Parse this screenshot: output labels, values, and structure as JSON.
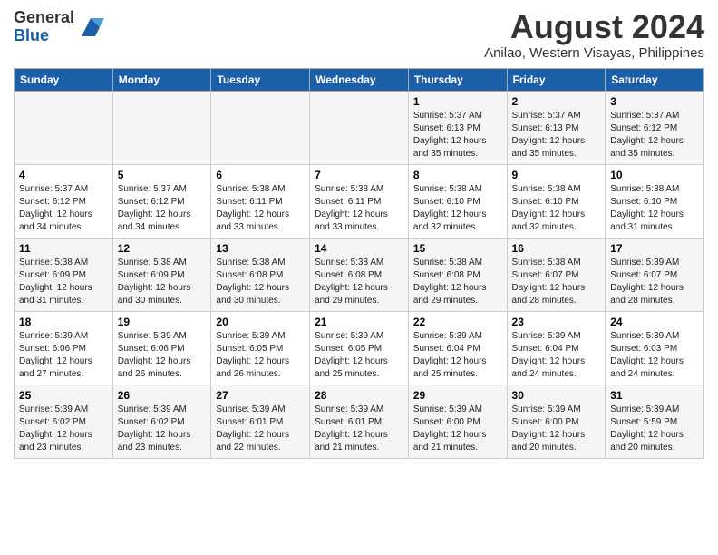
{
  "header": {
    "logo_line1": "General",
    "logo_line2": "Blue",
    "month_title": "August 2024",
    "subtitle": "Anilao, Western Visayas, Philippines"
  },
  "calendar": {
    "days_of_week": [
      "Sunday",
      "Monday",
      "Tuesday",
      "Wednesday",
      "Thursday",
      "Friday",
      "Saturday"
    ],
    "weeks": [
      [
        {
          "day": "",
          "info": ""
        },
        {
          "day": "",
          "info": ""
        },
        {
          "day": "",
          "info": ""
        },
        {
          "day": "",
          "info": ""
        },
        {
          "day": "1",
          "info": "Sunrise: 5:37 AM\nSunset: 6:13 PM\nDaylight: 12 hours\nand 35 minutes."
        },
        {
          "day": "2",
          "info": "Sunrise: 5:37 AM\nSunset: 6:13 PM\nDaylight: 12 hours\nand 35 minutes."
        },
        {
          "day": "3",
          "info": "Sunrise: 5:37 AM\nSunset: 6:12 PM\nDaylight: 12 hours\nand 35 minutes."
        }
      ],
      [
        {
          "day": "4",
          "info": "Sunrise: 5:37 AM\nSunset: 6:12 PM\nDaylight: 12 hours\nand 34 minutes."
        },
        {
          "day": "5",
          "info": "Sunrise: 5:37 AM\nSunset: 6:12 PM\nDaylight: 12 hours\nand 34 minutes."
        },
        {
          "day": "6",
          "info": "Sunrise: 5:38 AM\nSunset: 6:11 PM\nDaylight: 12 hours\nand 33 minutes."
        },
        {
          "day": "7",
          "info": "Sunrise: 5:38 AM\nSunset: 6:11 PM\nDaylight: 12 hours\nand 33 minutes."
        },
        {
          "day": "8",
          "info": "Sunrise: 5:38 AM\nSunset: 6:10 PM\nDaylight: 12 hours\nand 32 minutes."
        },
        {
          "day": "9",
          "info": "Sunrise: 5:38 AM\nSunset: 6:10 PM\nDaylight: 12 hours\nand 32 minutes."
        },
        {
          "day": "10",
          "info": "Sunrise: 5:38 AM\nSunset: 6:10 PM\nDaylight: 12 hours\nand 31 minutes."
        }
      ],
      [
        {
          "day": "11",
          "info": "Sunrise: 5:38 AM\nSunset: 6:09 PM\nDaylight: 12 hours\nand 31 minutes."
        },
        {
          "day": "12",
          "info": "Sunrise: 5:38 AM\nSunset: 6:09 PM\nDaylight: 12 hours\nand 30 minutes."
        },
        {
          "day": "13",
          "info": "Sunrise: 5:38 AM\nSunset: 6:08 PM\nDaylight: 12 hours\nand 30 minutes."
        },
        {
          "day": "14",
          "info": "Sunrise: 5:38 AM\nSunset: 6:08 PM\nDaylight: 12 hours\nand 29 minutes."
        },
        {
          "day": "15",
          "info": "Sunrise: 5:38 AM\nSunset: 6:08 PM\nDaylight: 12 hours\nand 29 minutes."
        },
        {
          "day": "16",
          "info": "Sunrise: 5:38 AM\nSunset: 6:07 PM\nDaylight: 12 hours\nand 28 minutes."
        },
        {
          "day": "17",
          "info": "Sunrise: 5:39 AM\nSunset: 6:07 PM\nDaylight: 12 hours\nand 28 minutes."
        }
      ],
      [
        {
          "day": "18",
          "info": "Sunrise: 5:39 AM\nSunset: 6:06 PM\nDaylight: 12 hours\nand 27 minutes."
        },
        {
          "day": "19",
          "info": "Sunrise: 5:39 AM\nSunset: 6:06 PM\nDaylight: 12 hours\nand 26 minutes."
        },
        {
          "day": "20",
          "info": "Sunrise: 5:39 AM\nSunset: 6:05 PM\nDaylight: 12 hours\nand 26 minutes."
        },
        {
          "day": "21",
          "info": "Sunrise: 5:39 AM\nSunset: 6:05 PM\nDaylight: 12 hours\nand 25 minutes."
        },
        {
          "day": "22",
          "info": "Sunrise: 5:39 AM\nSunset: 6:04 PM\nDaylight: 12 hours\nand 25 minutes."
        },
        {
          "day": "23",
          "info": "Sunrise: 5:39 AM\nSunset: 6:04 PM\nDaylight: 12 hours\nand 24 minutes."
        },
        {
          "day": "24",
          "info": "Sunrise: 5:39 AM\nSunset: 6:03 PM\nDaylight: 12 hours\nand 24 minutes."
        }
      ],
      [
        {
          "day": "25",
          "info": "Sunrise: 5:39 AM\nSunset: 6:02 PM\nDaylight: 12 hours\nand 23 minutes."
        },
        {
          "day": "26",
          "info": "Sunrise: 5:39 AM\nSunset: 6:02 PM\nDaylight: 12 hours\nand 23 minutes."
        },
        {
          "day": "27",
          "info": "Sunrise: 5:39 AM\nSunset: 6:01 PM\nDaylight: 12 hours\nand 22 minutes."
        },
        {
          "day": "28",
          "info": "Sunrise: 5:39 AM\nSunset: 6:01 PM\nDaylight: 12 hours\nand 21 minutes."
        },
        {
          "day": "29",
          "info": "Sunrise: 5:39 AM\nSunset: 6:00 PM\nDaylight: 12 hours\nand 21 minutes."
        },
        {
          "day": "30",
          "info": "Sunrise: 5:39 AM\nSunset: 6:00 PM\nDaylight: 12 hours\nand 20 minutes."
        },
        {
          "day": "31",
          "info": "Sunrise: 5:39 AM\nSunset: 5:59 PM\nDaylight: 12 hours\nand 20 minutes."
        }
      ]
    ]
  }
}
